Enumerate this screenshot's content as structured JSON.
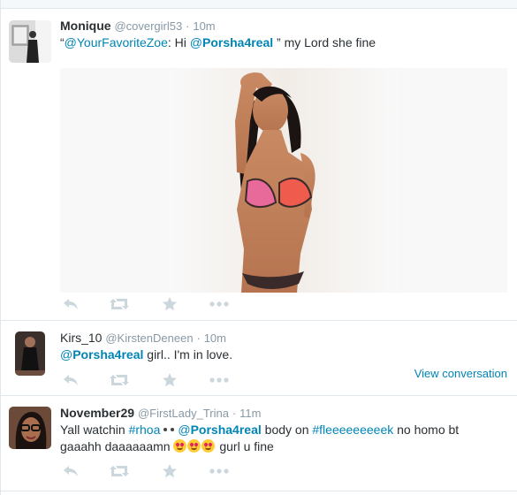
{
  "colors": {
    "link": "#0084b4",
    "muted": "#8899a6",
    "icon": "#ccd6dd",
    "border": "#e1e8ed"
  },
  "tweets": [
    {
      "fullname": "Monique",
      "username": "@covergirl53",
      "separator": "·",
      "time": "10m",
      "text": {
        "quote_open": "“",
        "mention1": "@YourFavoriteZoe",
        "colon": ": Hi ",
        "mention2_at": "@",
        "mention2": "Porsha4real",
        "rest": " ” my Lord she fine"
      },
      "media": "photo",
      "actions": [
        "reply-icon",
        "retweet-icon",
        "favorite-icon",
        "more-icon"
      ]
    },
    {
      "fullname": "Kirs_10",
      "username": "@KirstenDeneen",
      "separator": "·",
      "time": "10m",
      "text": {
        "mention_at": "@",
        "mention": "Porsha4real",
        "rest": " girl.. I'm in love."
      },
      "view_conversation": "View conversation",
      "actions": [
        "reply-icon",
        "retweet-icon",
        "favorite-icon",
        "more-icon"
      ]
    },
    {
      "fullname": "November29",
      "username": "@FirstLady_Trina",
      "separator": "·",
      "time": "11m",
      "text": {
        "part1": "Yall watchin ",
        "hashtag1": "#rhoa",
        "mention_at": "@",
        "mention": "Porsha4real",
        "part2": " body on ",
        "hashtag2": "#fleeeeeeeeek",
        "part3": " no homo bt",
        "line2a": "gaaahh daaaaaamn ",
        "line2b": " gurl u fine"
      },
      "actions": [
        "reply-icon",
        "retweet-icon",
        "favorite-icon",
        "more-icon"
      ]
    }
  ]
}
